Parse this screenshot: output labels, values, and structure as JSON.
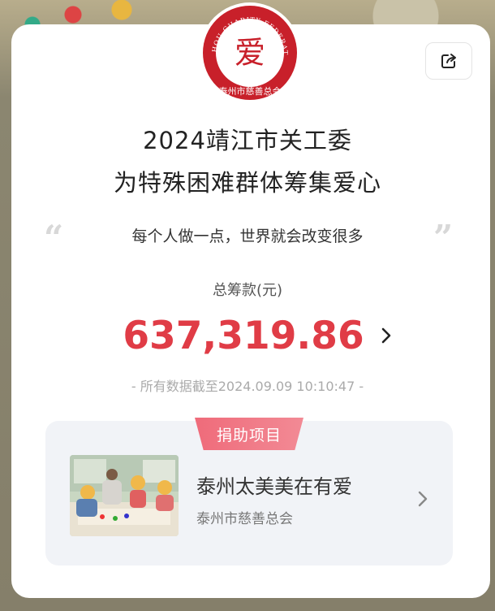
{
  "logo": {
    "arc_text": "TAIZHOU CHARITY FEDERATION",
    "center_char": "爱",
    "bottom_text": "泰州市慈善总会"
  },
  "header": {
    "title_line1": "2024靖江市关工委",
    "title_line2": "为特殊困难群体筹集爱心"
  },
  "slogan": {
    "open_quote": "“",
    "text": "每个人做一点，世界就会改变很多",
    "close_quote": "”"
  },
  "total": {
    "label": "总筹款(元)",
    "amount": "637,319.86"
  },
  "data_note": "- 所有数据截至2024.09.09 10:10:47 -",
  "project": {
    "tag": "捐助项目",
    "name": "泰州太美美在有爱",
    "organization": "泰州市慈善总会"
  },
  "icons": {
    "share": "share-icon",
    "chevron": "chevron-right-icon"
  },
  "colors": {
    "accent_red": "#e03c46",
    "tag_pink": "#ef6b7a",
    "logo_red": "#c8202a"
  }
}
